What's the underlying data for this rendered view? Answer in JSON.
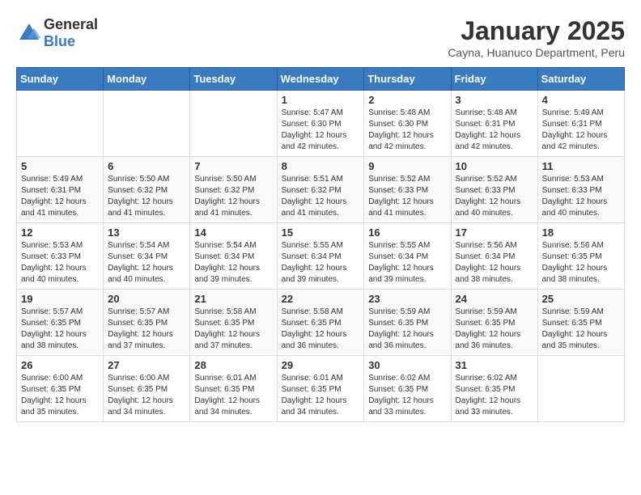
{
  "logo": {
    "general": "General",
    "blue": "Blue"
  },
  "title": "January 2025",
  "location": "Cayna, Huanuco Department, Peru",
  "days_of_week": [
    "Sunday",
    "Monday",
    "Tuesday",
    "Wednesday",
    "Thursday",
    "Friday",
    "Saturday"
  ],
  "weeks": [
    [
      {
        "day": "",
        "sunrise": "",
        "sunset": "",
        "daylight": ""
      },
      {
        "day": "",
        "sunrise": "",
        "sunset": "",
        "daylight": ""
      },
      {
        "day": "",
        "sunrise": "",
        "sunset": "",
        "daylight": ""
      },
      {
        "day": "1",
        "sunrise": "Sunrise: 5:47 AM",
        "sunset": "Sunset: 6:30 PM",
        "daylight": "Daylight: 12 hours and 42 minutes."
      },
      {
        "day": "2",
        "sunrise": "Sunrise: 5:48 AM",
        "sunset": "Sunset: 6:30 PM",
        "daylight": "Daylight: 12 hours and 42 minutes."
      },
      {
        "day": "3",
        "sunrise": "Sunrise: 5:48 AM",
        "sunset": "Sunset: 6:31 PM",
        "daylight": "Daylight: 12 hours and 42 minutes."
      },
      {
        "day": "4",
        "sunrise": "Sunrise: 5:49 AM",
        "sunset": "Sunset: 6:31 PM",
        "daylight": "Daylight: 12 hours and 42 minutes."
      }
    ],
    [
      {
        "day": "5",
        "sunrise": "Sunrise: 5:49 AM",
        "sunset": "Sunset: 6:31 PM",
        "daylight": "Daylight: 12 hours and 41 minutes."
      },
      {
        "day": "6",
        "sunrise": "Sunrise: 5:50 AM",
        "sunset": "Sunset: 6:32 PM",
        "daylight": "Daylight: 12 hours and 41 minutes."
      },
      {
        "day": "7",
        "sunrise": "Sunrise: 5:50 AM",
        "sunset": "Sunset: 6:32 PM",
        "daylight": "Daylight: 12 hours and 41 minutes."
      },
      {
        "day": "8",
        "sunrise": "Sunrise: 5:51 AM",
        "sunset": "Sunset: 6:32 PM",
        "daylight": "Daylight: 12 hours and 41 minutes."
      },
      {
        "day": "9",
        "sunrise": "Sunrise: 5:52 AM",
        "sunset": "Sunset: 6:33 PM",
        "daylight": "Daylight: 12 hours and 41 minutes."
      },
      {
        "day": "10",
        "sunrise": "Sunrise: 5:52 AM",
        "sunset": "Sunset: 6:33 PM",
        "daylight": "Daylight: 12 hours and 40 minutes."
      },
      {
        "day": "11",
        "sunrise": "Sunrise: 5:53 AM",
        "sunset": "Sunset: 6:33 PM",
        "daylight": "Daylight: 12 hours and 40 minutes."
      }
    ],
    [
      {
        "day": "12",
        "sunrise": "Sunrise: 5:53 AM",
        "sunset": "Sunset: 6:33 PM",
        "daylight": "Daylight: 12 hours and 40 minutes."
      },
      {
        "day": "13",
        "sunrise": "Sunrise: 5:54 AM",
        "sunset": "Sunset: 6:34 PM",
        "daylight": "Daylight: 12 hours and 40 minutes."
      },
      {
        "day": "14",
        "sunrise": "Sunrise: 5:54 AM",
        "sunset": "Sunset: 6:34 PM",
        "daylight": "Daylight: 12 hours and 39 minutes."
      },
      {
        "day": "15",
        "sunrise": "Sunrise: 5:55 AM",
        "sunset": "Sunset: 6:34 PM",
        "daylight": "Daylight: 12 hours and 39 minutes."
      },
      {
        "day": "16",
        "sunrise": "Sunrise: 5:55 AM",
        "sunset": "Sunset: 6:34 PM",
        "daylight": "Daylight: 12 hours and 39 minutes."
      },
      {
        "day": "17",
        "sunrise": "Sunrise: 5:56 AM",
        "sunset": "Sunset: 6:34 PM",
        "daylight": "Daylight: 12 hours and 38 minutes."
      },
      {
        "day": "18",
        "sunrise": "Sunrise: 5:56 AM",
        "sunset": "Sunset: 6:35 PM",
        "daylight": "Daylight: 12 hours and 38 minutes."
      }
    ],
    [
      {
        "day": "19",
        "sunrise": "Sunrise: 5:57 AM",
        "sunset": "Sunset: 6:35 PM",
        "daylight": "Daylight: 12 hours and 38 minutes."
      },
      {
        "day": "20",
        "sunrise": "Sunrise: 5:57 AM",
        "sunset": "Sunset: 6:35 PM",
        "daylight": "Daylight: 12 hours and 37 minutes."
      },
      {
        "day": "21",
        "sunrise": "Sunrise: 5:58 AM",
        "sunset": "Sunset: 6:35 PM",
        "daylight": "Daylight: 12 hours and 37 minutes."
      },
      {
        "day": "22",
        "sunrise": "Sunrise: 5:58 AM",
        "sunset": "Sunset: 6:35 PM",
        "daylight": "Daylight: 12 hours and 36 minutes."
      },
      {
        "day": "23",
        "sunrise": "Sunrise: 5:59 AM",
        "sunset": "Sunset: 6:35 PM",
        "daylight": "Daylight: 12 hours and 36 minutes."
      },
      {
        "day": "24",
        "sunrise": "Sunrise: 5:59 AM",
        "sunset": "Sunset: 6:35 PM",
        "daylight": "Daylight: 12 hours and 36 minutes."
      },
      {
        "day": "25",
        "sunrise": "Sunrise: 5:59 AM",
        "sunset": "Sunset: 6:35 PM",
        "daylight": "Daylight: 12 hours and 35 minutes."
      }
    ],
    [
      {
        "day": "26",
        "sunrise": "Sunrise: 6:00 AM",
        "sunset": "Sunset: 6:35 PM",
        "daylight": "Daylight: 12 hours and 35 minutes."
      },
      {
        "day": "27",
        "sunrise": "Sunrise: 6:00 AM",
        "sunset": "Sunset: 6:35 PM",
        "daylight": "Daylight: 12 hours and 34 minutes."
      },
      {
        "day": "28",
        "sunrise": "Sunrise: 6:01 AM",
        "sunset": "Sunset: 6:35 PM",
        "daylight": "Daylight: 12 hours and 34 minutes."
      },
      {
        "day": "29",
        "sunrise": "Sunrise: 6:01 AM",
        "sunset": "Sunset: 6:35 PM",
        "daylight": "Daylight: 12 hours and 34 minutes."
      },
      {
        "day": "30",
        "sunrise": "Sunrise: 6:02 AM",
        "sunset": "Sunset: 6:35 PM",
        "daylight": "Daylight: 12 hours and 33 minutes."
      },
      {
        "day": "31",
        "sunrise": "Sunrise: 6:02 AM",
        "sunset": "Sunset: 6:35 PM",
        "daylight": "Daylight: 12 hours and 33 minutes."
      },
      {
        "day": "",
        "sunrise": "",
        "sunset": "",
        "daylight": ""
      }
    ]
  ]
}
